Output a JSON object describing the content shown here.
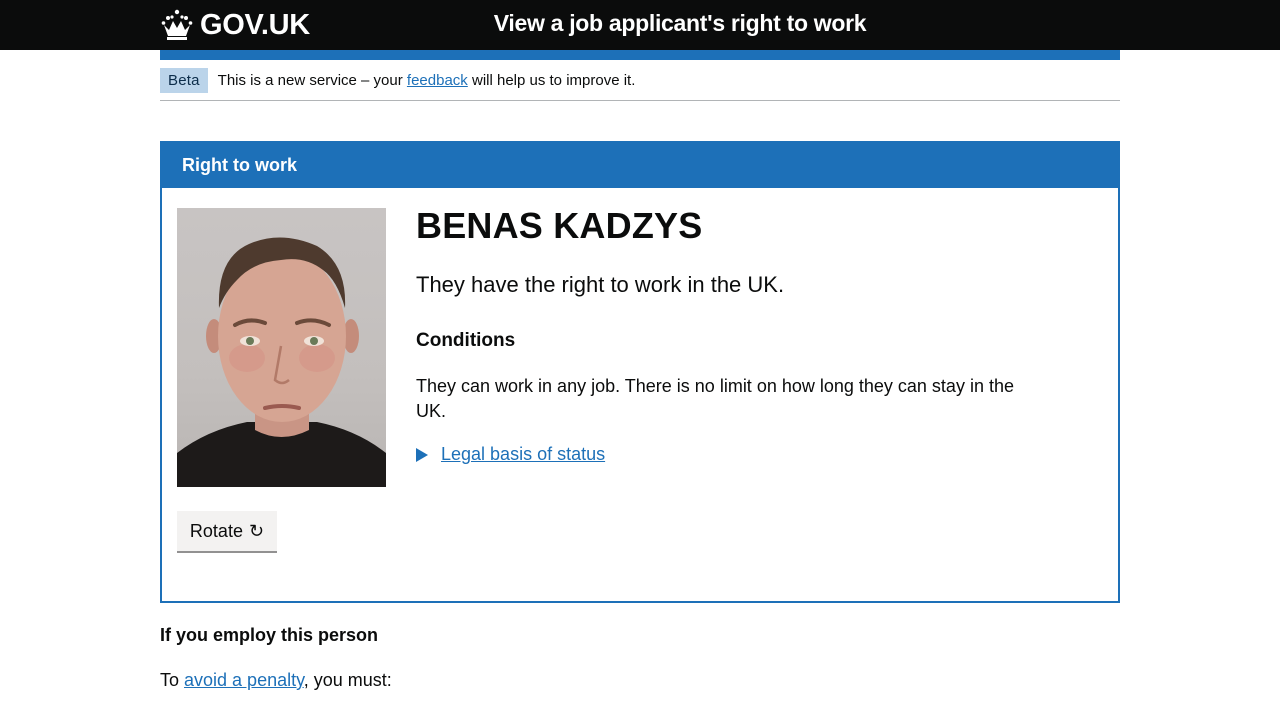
{
  "header": {
    "logo_text": "GOV.UK",
    "service_name": "View a job applicant's right to work",
    "crown_icon": "crown-icon"
  },
  "phase_banner": {
    "tag": "Beta",
    "text_before": "This is a new service – your ",
    "link": "feedback",
    "text_after": " will help us to improve it."
  },
  "panel": {
    "title": "Right to work",
    "photo_icon": "applicant-photo",
    "rotate_label": "Rotate",
    "rotate_icon": "↻",
    "name": "BENAS KADZYS",
    "status": "They have the right to work in the UK.",
    "conditions_heading": "Conditions",
    "conditions_text": "They can work in any job. There is no limit on how long they can stay in the UK.",
    "details_link": "Legal basis of status"
  },
  "employ": {
    "heading": "If you employ this person",
    "to_text": "To ",
    "penalty_link": "avoid a penalty",
    "must_text": ", you must:"
  },
  "colors": {
    "header_bg": "#0b0c0c",
    "brand_blue": "#1d70b8",
    "tag_bg": "#bbd4ea",
    "button_bg": "#f3f2f1"
  }
}
